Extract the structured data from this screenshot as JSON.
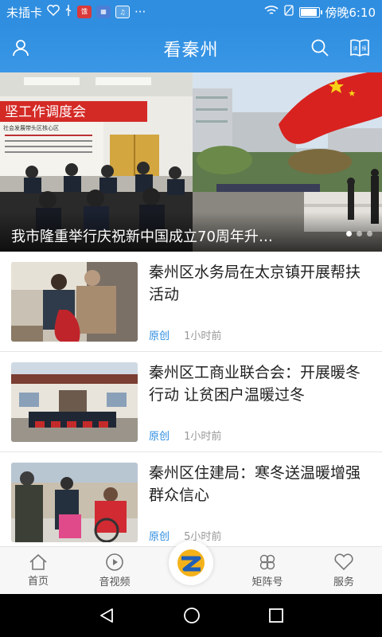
{
  "status_bar": {
    "carrier": "未插卡",
    "time": "傍晚6:10",
    "badge_1": "饿",
    "battery_level": 0.95
  },
  "header": {
    "title": "看秦州"
  },
  "carousel": {
    "caption": "我市隆重举行庆祝新中国成立70周年升…",
    "banner_text": "坚工作调度会",
    "banner_sub": "社会发展带头区核心区",
    "active_dot": 0,
    "dot_count": 3
  },
  "news": [
    {
      "title": "秦州区水务局在太京镇开展帮扶活动",
      "tag": "原创",
      "time": "1小时前"
    },
    {
      "title": "秦州区工商业联合会：开展暖冬行动 让贫困户温暖过冬",
      "tag": "原创",
      "time": "1小时前"
    },
    {
      "title": "秦州区住建局：寒冬送温暖增强群众信心",
      "tag": "原创",
      "time": "5小时前"
    }
  ],
  "bottom_nav": {
    "home": "首页",
    "video": "音视频",
    "matrix": "矩阵号",
    "service": "服务"
  },
  "colors": {
    "primary": "#2f8ee0",
    "tag": "#2f8ee0"
  }
}
